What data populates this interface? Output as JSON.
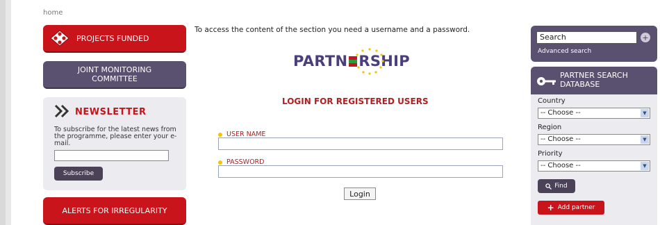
{
  "breadcrumb": "home",
  "left": {
    "projects_funded": "PROJECTS FUNDED",
    "joint_monitoring": "JOINT MONITORING COMMITTEE",
    "newsletter": {
      "title": "NEWSLETTER",
      "text": "To subscribe for the latest news from the programme, please enter your e-mail.",
      "email_value": "",
      "subscribe_label": "Subscribe"
    },
    "alerts": "ALERTS FOR IRREGULARITY"
  },
  "main": {
    "access_message": "To access the content of the section you need a username and a password.",
    "logo_text": "PARTN RSHIP",
    "login_title": "LOGIN FOR REGISTERED USERS",
    "username_label": "USER NAME",
    "username_value": "",
    "password_label": "PASSWORD",
    "password_value": "",
    "login_button": "Login"
  },
  "right": {
    "search": {
      "value": "Search",
      "go_icon": "plus-circle-icon",
      "advanced": "Advanced search"
    },
    "partner_search": {
      "title": "PARTNER SEARCH DATABASE",
      "icon": "key-icon",
      "country_label": "Country",
      "country_value": "-- Choose --",
      "region_label": "Region",
      "region_value": "-- Choose --",
      "priority_label": "Priority",
      "priority_value": "-- Choose --",
      "find_label": "Find",
      "add_partner_label": "Add partner"
    }
  },
  "colors": {
    "brand_red": "#c8141a",
    "brand_purple": "#5a5070",
    "logo_purple": "#4a3f7a",
    "star_yellow": "#f3c400"
  }
}
